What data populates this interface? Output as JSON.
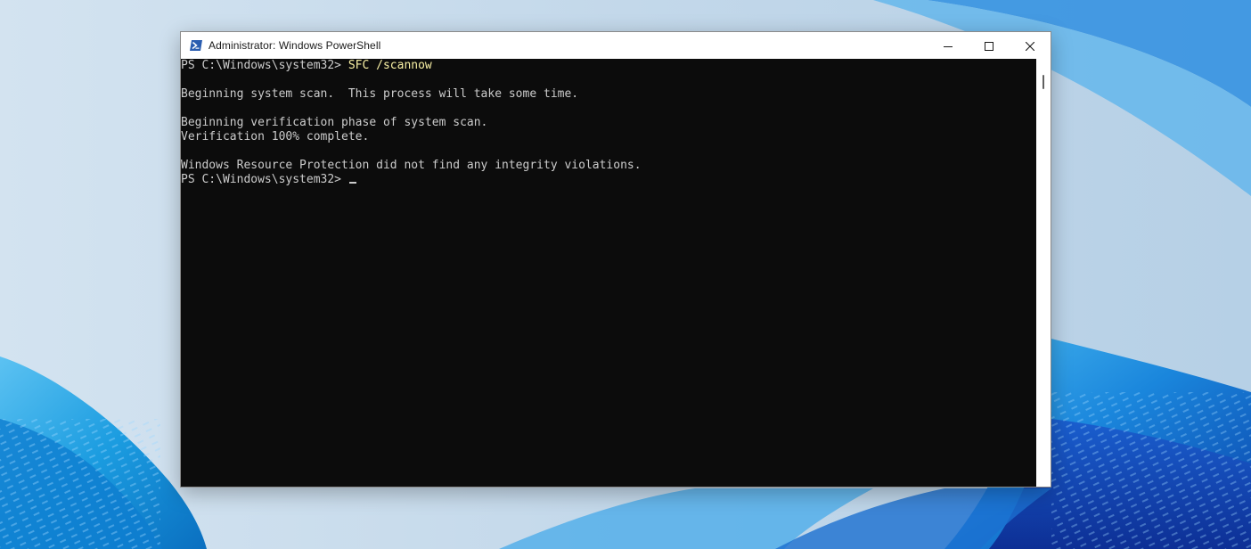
{
  "window": {
    "title": "Administrator: Windows PowerShell",
    "icon": "powershell-icon",
    "controls": {
      "minimize": "minimize-icon",
      "maximize": "maximize-icon",
      "close": "close-icon"
    }
  },
  "console": {
    "prompt": "PS C:\\Windows\\system32> ",
    "command": "SFC /scannow",
    "output": [
      "",
      "Beginning system scan.  This process will take some time.",
      "",
      "Beginning verification phase of system scan.",
      "Verification 100% complete.",
      "",
      "Windows Resource Protection did not find any integrity violations."
    ],
    "final_prompt": "PS C:\\Windows\\system32> "
  },
  "colors": {
    "console_bg": "#0c0c0c",
    "console_text": "#cccccc",
    "command_text": "#f9f1a5",
    "titlebar_bg": "#ffffff"
  }
}
